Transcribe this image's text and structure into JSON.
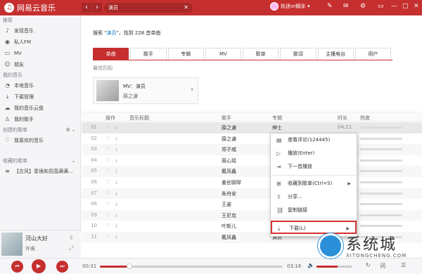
{
  "app": {
    "name": "网易云音乐"
  },
  "search": {
    "query": "演员"
  },
  "user": {
    "name": "执迷or糊涂"
  },
  "sidebar": {
    "sections": [
      {
        "header": "推荐",
        "items": [
          {
            "icon": "music-note-icon",
            "label": "发现音乐"
          },
          {
            "icon": "radio-icon",
            "label": "私人FM"
          },
          {
            "icon": "video-icon",
            "label": "MV"
          },
          {
            "icon": "friends-icon",
            "label": "朋友"
          }
        ]
      },
      {
        "header": "我的音乐",
        "items": [
          {
            "icon": "local-music-icon",
            "label": "本地音乐"
          },
          {
            "icon": "download-icon",
            "label": "下载管理"
          },
          {
            "icon": "cloud-icon",
            "label": "我的音乐云盘"
          },
          {
            "icon": "singer-icon",
            "label": "我的歌手"
          }
        ]
      },
      {
        "header": "创建的歌单",
        "items": [
          {
            "icon": "heart-icon",
            "label": "我喜欢的音乐"
          }
        ]
      },
      {
        "header": "收藏的歌单",
        "items": [
          {
            "icon": "playlist-icon",
            "label": "【古风】意境和氛围满满..."
          }
        ]
      }
    ]
  },
  "now_playing": {
    "title": "河山大好",
    "artist": "许嵩"
  },
  "main": {
    "summary_prefix": "搜索 \"",
    "summary_keyword": "演员",
    "summary_suffix": "\"，找到 228 首单曲",
    "tabs": [
      "单曲",
      "歌手",
      "专辑",
      "MV",
      "歌单",
      "歌词",
      "主播电台",
      "用户"
    ],
    "best_match_label": "最佳匹配",
    "best_card": {
      "title": "MV：演员",
      "artist": "薛之谦"
    },
    "table_headers": {
      "action": "操作",
      "title": "音乐标题",
      "artist": "歌手",
      "album": "专辑",
      "duration": "时长",
      "heat": "热度"
    },
    "rows": [
      {
        "no": "01",
        "title_pre": "",
        "title_hl": "演员",
        "title_post": "",
        "sq": true,
        "mv": true,
        "artist": "薛之谦",
        "album": "绅士",
        "duration": "04:21"
      },
      {
        "no": "02",
        "title_pre": "",
        "title_hl": "演员",
        "title_post": "",
        "sq": true,
        "mv": false,
        "artist": "薛之谦",
        "album": "",
        "duration": ""
      },
      {
        "no": "03",
        "title_pre": "编剧《",
        "title_hl": "演员",
        "title_post": "》粤语版",
        "sq": false,
        "mv": false,
        "artist": "郑子威",
        "album": "",
        "duration": ""
      },
      {
        "no": "04",
        "title_pre": "",
        "title_hl": "演员",
        "title_post": "（女声Cover）",
        "sq": true,
        "mv": false,
        "artist": "周心瑶",
        "album": "",
        "duration": ""
      },
      {
        "no": "05",
        "title_pre": "",
        "title_hl": "演员",
        "title_post": "（高考新）超笑改编",
        "sq": false,
        "mv": false,
        "artist": "戴凤鑫",
        "album": "",
        "duration": ""
      },
      {
        "no": "06",
        "title_pre": "薛之谦《",
        "title_hl": "演员",
        "title_post": "》-美创钢琴版",
        "sq": false,
        "mv": false,
        "artist": "姜创钢琴",
        "album": "",
        "duration": ""
      },
      {
        "no": "07",
        "title_pre": "",
        "title_hl": "演员",
        "title_post": "",
        "sq": false,
        "mv": false,
        "artist": "朱舟安",
        "album": "",
        "duration": ""
      },
      {
        "no": "08",
        "title_pre": "",
        "title_hl": "演员",
        "title_post": "",
        "sq": false,
        "mv": false,
        "artist": "王姿",
        "album": "",
        "duration": ""
      },
      {
        "no": "09",
        "title_pre": "",
        "title_hl": "演员",
        "title_post": "",
        "sq": false,
        "mv": false,
        "artist": "王尼克",
        "album": "",
        "duration": ""
      },
      {
        "no": "10",
        "title_pre": "",
        "title_hl": "演员",
        "title_post": "",
        "sq": false,
        "mv": false,
        "artist": "叶新儿",
        "album": "",
        "duration": ""
      },
      {
        "no": "11",
        "title_pre": "",
        "title_hl": "演员",
        "title_post": "（高低音切换版）自带和声",
        "sq": false,
        "mv": false,
        "artist": "戴凤鑫",
        "album": "演员",
        "duration": ""
      }
    ]
  },
  "context_menu": {
    "items": [
      {
        "icon": "comment-icon",
        "label": "查看评论(124445)",
        "submenu": false
      },
      {
        "icon": "play-circle-icon",
        "label": "播放(Enter)",
        "submenu": false
      },
      {
        "icon": "play-next-icon",
        "label": "下一首播放",
        "submenu": false
      },
      {
        "icon": "add-playlist-icon",
        "label": "收藏到歌单(Ctrl+S)",
        "submenu": true
      },
      {
        "icon": "share-icon",
        "label": "分享...",
        "submenu": false
      },
      {
        "icon": "link-icon",
        "label": "复制链接",
        "submenu": false
      },
      {
        "icon": "download-icon",
        "label": "下载(L)",
        "submenu": true
      }
    ]
  },
  "player": {
    "current_time": "00:31",
    "total_time": "03:16",
    "progress": 0.16,
    "volume": 0.6
  },
  "watermark": {
    "text": "系统城",
    "url": "XITONGCHENG.COM"
  },
  "colors": {
    "brand_red": "#c62f2f",
    "link_blue": "#0c73c2",
    "highlight_border": "#d83030"
  }
}
